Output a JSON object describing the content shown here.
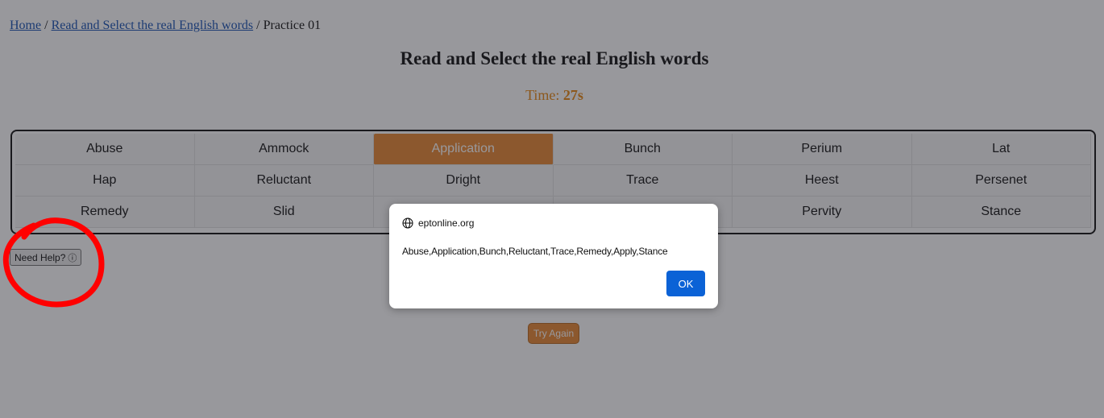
{
  "breadcrumb": {
    "home": "Home",
    "separator1": "/",
    "section": "Read and Select the real English words",
    "separator2": "/",
    "current": "Practice 01"
  },
  "title": "Read and Select the real English words",
  "timer": {
    "label": "Time:",
    "value": "27s"
  },
  "words": [
    [
      "Abuse",
      "Ammock",
      "Application",
      "Bunch",
      "Perium",
      "Lat"
    ],
    [
      "Hap",
      "Reluctant",
      "Dright",
      "Trace",
      "Heest",
      "Persenet"
    ],
    [
      "Remedy",
      "Slid",
      "",
      "",
      "Pervity",
      "Stance"
    ]
  ],
  "selected_word": "Application",
  "help_button": {
    "label": "Need Help?",
    "icon": "info-icon"
  },
  "try_again": "Try Again",
  "dialog": {
    "origin": "eptonline.org",
    "origin_icon": "globe-icon",
    "message": "Abuse,Application,Bunch,Reluctant,Trace,Remedy,Apply,Stance",
    "ok": "OK"
  },
  "colors": {
    "accent": "#e67e22",
    "link": "#0645ad",
    "dialog_button": "#0b62d6",
    "annotation": "#ff0000"
  }
}
